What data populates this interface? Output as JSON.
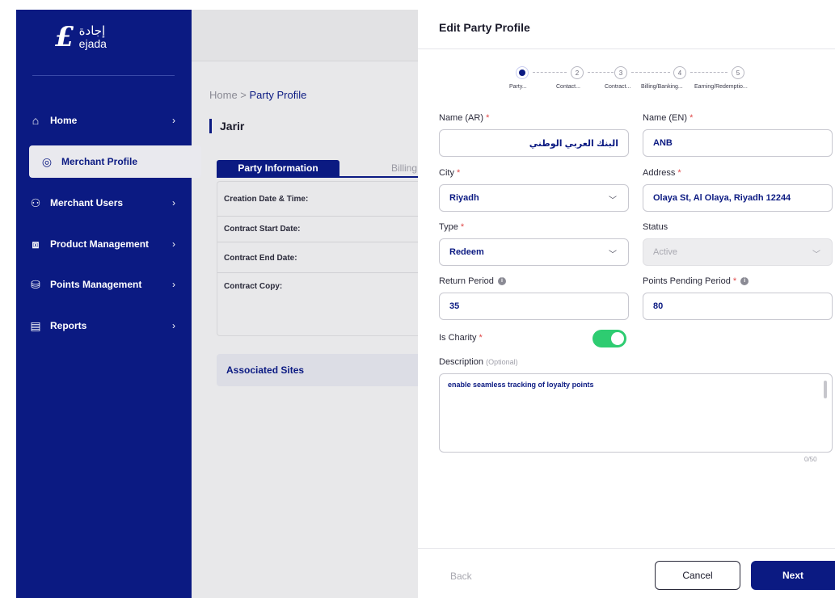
{
  "brand": {
    "logo_ar": "إجادة",
    "logo_en": "ejada",
    "accent": "#0b1a82",
    "toggle_on": "#2ecc71"
  },
  "sidebar": {
    "items": [
      {
        "label": "Home",
        "icon": "home-icon",
        "has_chevron": true
      },
      {
        "label": "Merchant Profile",
        "icon": "profile-icon",
        "active": true
      },
      {
        "label": "Merchant Users",
        "icon": "users-icon",
        "has_chevron": true
      },
      {
        "label": "Product Management",
        "icon": "box-icon",
        "has_chevron": true
      },
      {
        "label": "Points Management",
        "icon": "points-icon",
        "has_chevron": true
      },
      {
        "label": "Reports",
        "icon": "report-icon",
        "has_chevron": true
      }
    ]
  },
  "page": {
    "breadcrumb_home": "Home",
    "breadcrumb_sep": " > ",
    "breadcrumb_current": "Party Profile",
    "title": "Jarir",
    "tab_active": "Party Information",
    "tab_billing": "Billing",
    "info_rows": [
      "Creation Date & Time:",
      "Contract Start Date:",
      "Contract End Date:",
      "Contract Copy:"
    ],
    "associated_sites": "Associated Sites"
  },
  "drawer": {
    "title": "Edit Party Profile",
    "steps": [
      {
        "number": "1",
        "label": "Party...",
        "active": true
      },
      {
        "number": "2",
        "label": "Contact..."
      },
      {
        "number": "3",
        "label": "Contract..."
      },
      {
        "number": "4",
        "label": "Billing/Banking..."
      },
      {
        "number": "5",
        "label": "Earning/Redemptio..."
      }
    ],
    "fields": {
      "name_ar": {
        "label": "Name (AR)",
        "value": "البنك العربي الوطني"
      },
      "name_en": {
        "label": "Name (EN)",
        "value": "ANB"
      },
      "city": {
        "label": "City",
        "value": "Riyadh"
      },
      "address": {
        "label": "Address",
        "value": "Olaya St, Al Olaya, Riyadh 12244"
      },
      "type": {
        "label": "Type",
        "value": "Redeem"
      },
      "status": {
        "label": "Status",
        "value": "Active"
      },
      "return_period": {
        "label": "Return Period",
        "value": "35"
      },
      "points_pending_period": {
        "label": "Points Pending Period",
        "value": "80"
      },
      "is_charity": {
        "label": "Is Charity",
        "value": true
      },
      "description": {
        "label": "Description",
        "optional": "(Optional)",
        "value": "enable seamless tracking of loyalty points",
        "counter": "0/50"
      }
    },
    "required_mark": "*",
    "info_glyph": "i",
    "buttons": {
      "back": "Back",
      "cancel": "Cancel",
      "next": "Next"
    }
  }
}
